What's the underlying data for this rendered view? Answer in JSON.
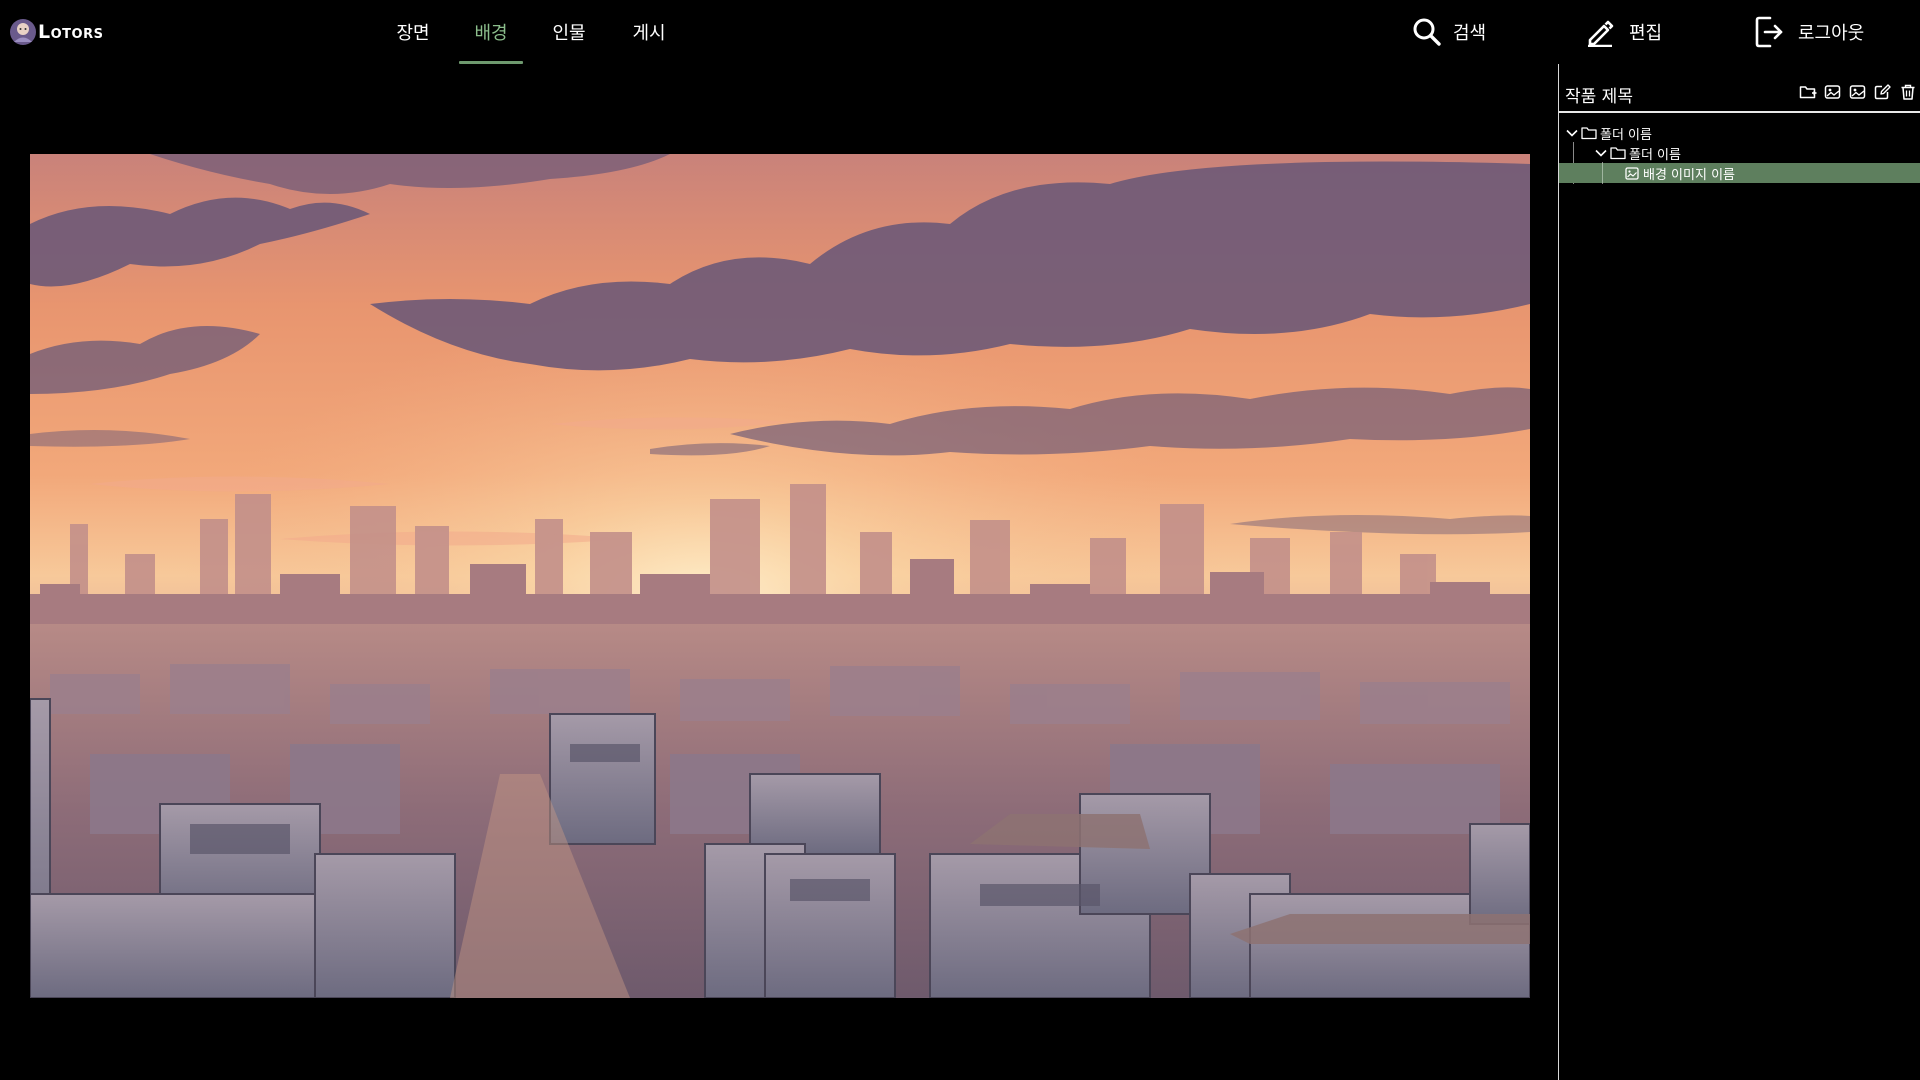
{
  "app": {
    "logo_text": "Lotors"
  },
  "nav": {
    "tabs": [
      {
        "label": "장면",
        "active": false
      },
      {
        "label": "배경",
        "active": true
      },
      {
        "label": "인물",
        "active": false
      },
      {
        "label": "게시",
        "active": false
      }
    ]
  },
  "toolbar": {
    "search_label": "검색",
    "edit_label": "편집",
    "logout_label": "로그아웃",
    "icons": [
      "search-icon",
      "pencil-icon",
      "logout-icon"
    ]
  },
  "panel": {
    "project_title": "작품 제목",
    "actions": [
      "new-folder-icon",
      "add-image-icon",
      "replace-image-icon",
      "rename-icon",
      "delete-icon"
    ],
    "tree": [
      {
        "label": "폴더 이름",
        "type": "folder",
        "expanded": true,
        "level": 0
      },
      {
        "label": "폴더 이름",
        "type": "folder",
        "expanded": true,
        "level": 1
      },
      {
        "label": "배경 이미지 이름",
        "type": "image",
        "selected": true,
        "level": 2
      }
    ]
  },
  "colors": {
    "accent": "#8bbd8b",
    "underline": "#6f9a6f",
    "selected_row": "#5e7f5e",
    "background": "#000000"
  }
}
